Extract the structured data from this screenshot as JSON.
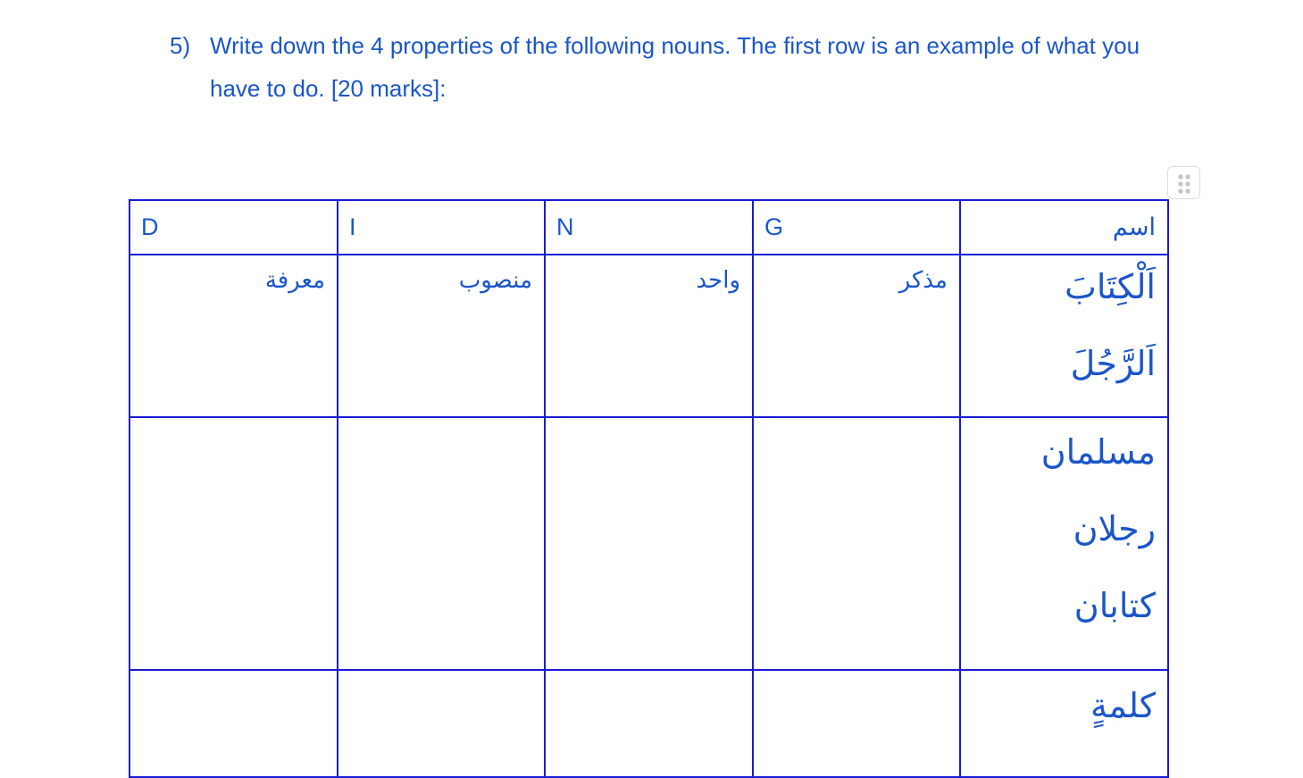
{
  "question": {
    "number": "5)",
    "text": "Write down the 4 properties of the following nouns. The first row is an example of what you have to do. [20 marks]:"
  },
  "table": {
    "headers": [
      "D",
      "I",
      "N",
      "G",
      "اسم"
    ],
    "rows": [
      {
        "nouns": [
          "اَلْكِتَابَ",
          "اَلرَّجُلَ"
        ],
        "properties": [
          "معرفة",
          "منصوب",
          "واحد",
          "مذكر"
        ]
      },
      {
        "nouns": [
          "مسلمان",
          "رجلان",
          "كتابان"
        ],
        "properties": [
          "",
          "",
          "",
          ""
        ]
      },
      {
        "nouns": [
          "كلمةٍ"
        ],
        "properties": [
          "",
          "",
          "",
          ""
        ]
      }
    ]
  },
  "drag_handle_icon": "drag-handle-dots-icon"
}
